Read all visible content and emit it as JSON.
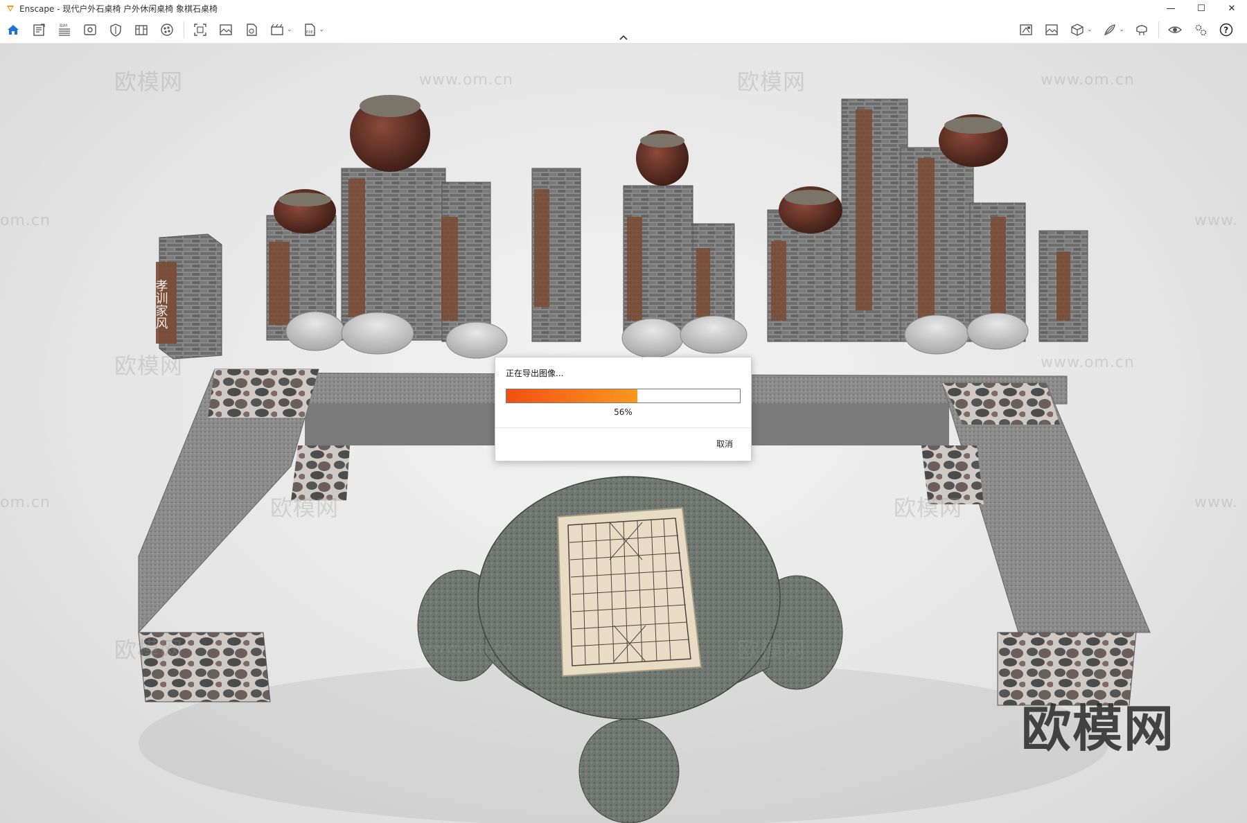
{
  "window": {
    "app_name": "Enscape",
    "title": "Enscape - 现代户外石桌椅 户外休闲桌椅 象棋石桌椅",
    "controls": {
      "minimize": "—",
      "maximize": "☐",
      "close": "✕"
    }
  },
  "toolbar": {
    "left_icons": [
      "home-icon",
      "project-info-icon",
      "bim-icon",
      "view-icon",
      "visual-settings-icon",
      "asset-library-icon",
      "material-editor-icon"
    ],
    "bim_label": "BIM",
    "capture_icons": [
      "screenshot-icon",
      "batch-render-icon",
      "render-panorama-icon",
      "video-editor-icon",
      "export-exe-icon"
    ],
    "exe_label": "EXE",
    "right_icons": [
      "sync-views-icon",
      "image-icon",
      "cube-view-icon",
      "paint-icon",
      "vr-headset-icon",
      "eye-icon",
      "settings-icon",
      "help-icon"
    ],
    "caret": "⌄"
  },
  "viewport": {
    "watermarks": [
      "欧模网",
      "www.om.cn",
      "om.cn",
      "www."
    ],
    "logo": "欧模网"
  },
  "dialog": {
    "title": "正在导出图像...",
    "progress_percent": 56,
    "progress_label": "56%",
    "cancel_label": "取消",
    "accent": "#f7741a"
  },
  "scene_text": {
    "plaque": "孝训家风"
  }
}
